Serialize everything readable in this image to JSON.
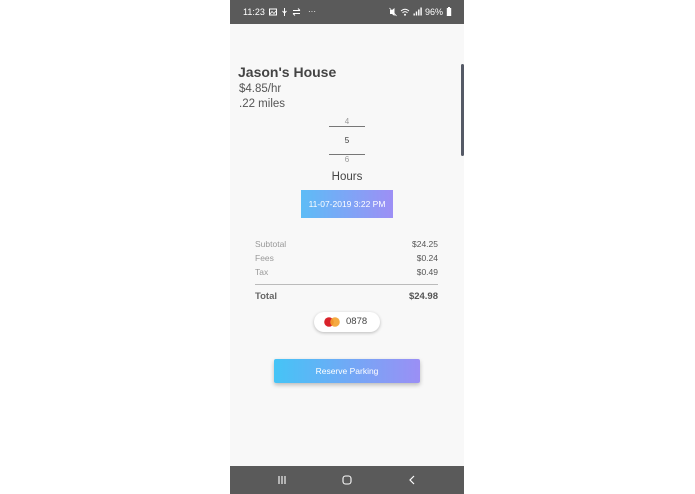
{
  "status_bar": {
    "time": "11:23",
    "battery": "96%",
    "overflow": "···",
    "left_icons": [
      "image-icon",
      "usb-icon",
      "transfer-icon"
    ],
    "right_icons": [
      "mute-icon",
      "wifi-icon",
      "signal-icon",
      "battery-icon"
    ]
  },
  "listing": {
    "name": "Jason's House",
    "rate": "$4.85/hr",
    "distance": ".22 miles"
  },
  "hours_picker": {
    "previous": "4",
    "current": "5",
    "next": "6",
    "label": "Hours"
  },
  "date_button": {
    "label": "11-07-2019 3:22 PM",
    "gradient": [
      "#5dbcf6",
      "#9d8ff5"
    ]
  },
  "summary": {
    "subtotal_label": "Subtotal",
    "subtotal_value": "$24.25",
    "fees_label": "Fees",
    "fees_value": "$0.24",
    "tax_label": "Tax",
    "tax_value": "$0.49",
    "total_label": "Total",
    "total_value": "$24.98"
  },
  "payment": {
    "card_brand_icon": "mastercard-icon",
    "card_last4": "0878"
  },
  "reserve_button": {
    "label": "Reserve Parking",
    "gradient": [
      "#45c4f6",
      "#9b8ff5"
    ]
  },
  "navigation_bar": {
    "icons": [
      "recents-icon",
      "home-icon",
      "back-icon"
    ]
  }
}
